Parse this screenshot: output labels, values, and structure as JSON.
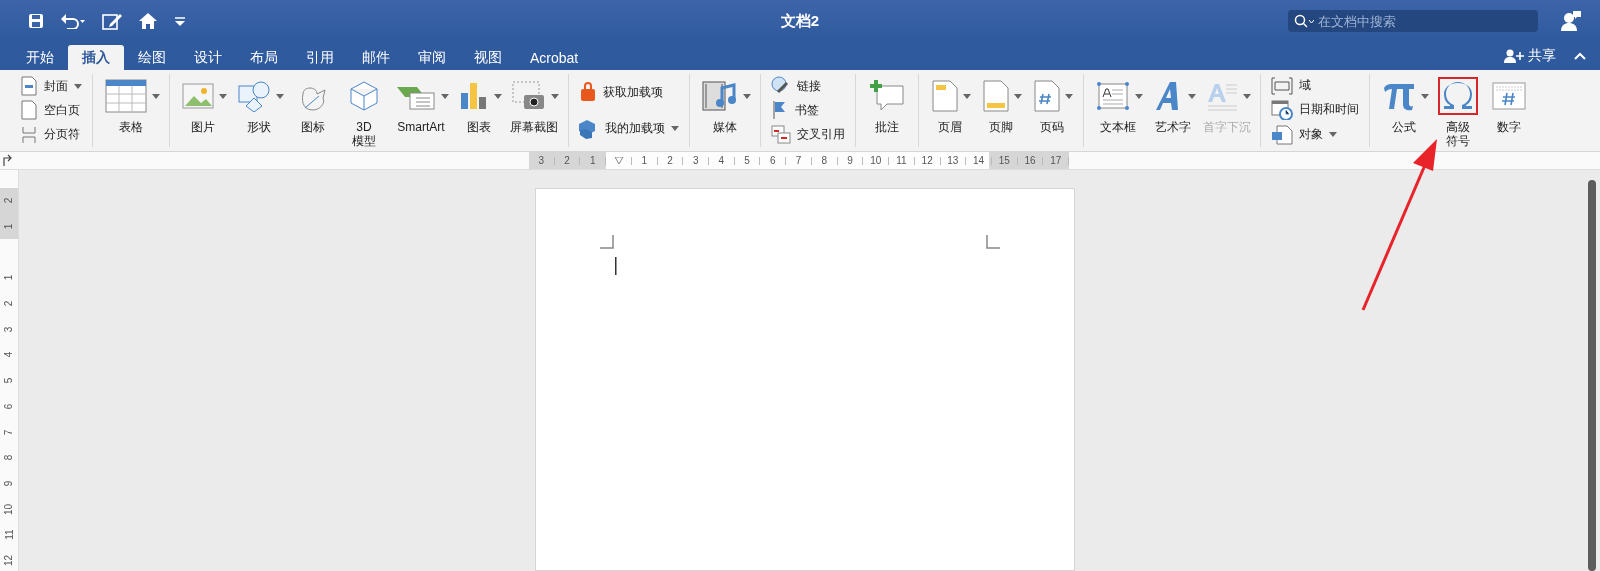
{
  "window": {
    "title": "文档2"
  },
  "search": {
    "placeholder": "在文档中搜索"
  },
  "tabs": [
    {
      "label": "开始",
      "selected": false
    },
    {
      "label": "插入",
      "selected": true
    },
    {
      "label": "绘图",
      "selected": false
    },
    {
      "label": "设计",
      "selected": false
    },
    {
      "label": "布局",
      "selected": false
    },
    {
      "label": "引用",
      "selected": false
    },
    {
      "label": "邮件",
      "selected": false
    },
    {
      "label": "审阅",
      "selected": false
    },
    {
      "label": "视图",
      "selected": false
    },
    {
      "label": "Acrobat",
      "selected": false
    }
  ],
  "share": {
    "label": "共享"
  },
  "ribbon_groups": [
    {
      "kind": "stack",
      "items": [
        {
          "label": "封面",
          "dropdown": true,
          "disabled": false
        },
        {
          "label": "空白页",
          "dropdown": false,
          "disabled": false
        },
        {
          "label": "分页符",
          "dropdown": false,
          "disabled": false
        }
      ]
    },
    {
      "kind": "large",
      "items": [
        {
          "lines": [
            "表格"
          ],
          "dropdown": true,
          "disabled": false,
          "highlighted": false
        }
      ]
    },
    {
      "kind": "large",
      "items": [
        {
          "lines": [
            "图片"
          ],
          "dropdown": true,
          "disabled": false,
          "highlighted": false
        },
        {
          "lines": [
            "形状"
          ],
          "dropdown": true,
          "disabled": false,
          "highlighted": false
        },
        {
          "lines": [
            "图标"
          ],
          "dropdown": false,
          "disabled": false,
          "highlighted": false
        },
        {
          "lines": [
            "3D",
            "模型"
          ],
          "dropdown": false,
          "disabled": false,
          "highlighted": false
        },
        {
          "lines": [
            "SmartArt"
          ],
          "dropdown": true,
          "disabled": false,
          "highlighted": false
        },
        {
          "lines": [
            "图表"
          ],
          "dropdown": true,
          "disabled": false,
          "highlighted": false
        },
        {
          "lines": [
            "屏幕截图"
          ],
          "dropdown": true,
          "disabled": false,
          "highlighted": false
        }
      ]
    },
    {
      "kind": "stack",
      "items": [
        {
          "label": "获取加载项",
          "dropdown": false,
          "disabled": false
        },
        {
          "label": "我的加载项",
          "dropdown": true,
          "disabled": false
        }
      ]
    },
    {
      "kind": "large",
      "items": [
        {
          "lines": [
            "媒体"
          ],
          "dropdown": true,
          "disabled": false,
          "highlighted": false
        }
      ]
    },
    {
      "kind": "stack",
      "items": [
        {
          "label": "链接",
          "dropdown": false,
          "disabled": false
        },
        {
          "label": "书签",
          "dropdown": false,
          "disabled": false
        },
        {
          "label": "交叉引用",
          "dropdown": false,
          "disabled": false
        }
      ]
    },
    {
      "kind": "large",
      "items": [
        {
          "lines": [
            "批注"
          ],
          "dropdown": false,
          "disabled": false,
          "highlighted": false
        }
      ]
    },
    {
      "kind": "large",
      "items": [
        {
          "lines": [
            "页眉"
          ],
          "dropdown": true,
          "disabled": false,
          "highlighted": false
        },
        {
          "lines": [
            "页脚"
          ],
          "dropdown": true,
          "disabled": false,
          "highlighted": false
        },
        {
          "lines": [
            "页码"
          ],
          "dropdown": true,
          "disabled": false,
          "highlighted": false
        }
      ]
    },
    {
      "kind": "large",
      "items": [
        {
          "lines": [
            "文本框"
          ],
          "dropdown": true,
          "disabled": false,
          "highlighted": false
        },
        {
          "lines": [
            "艺术字"
          ],
          "dropdown": true,
          "disabled": false,
          "highlighted": false
        },
        {
          "lines": [
            "首字下沉"
          ],
          "dropdown": true,
          "disabled": true,
          "highlighted": false
        }
      ]
    },
    {
      "kind": "stack",
      "items": [
        {
          "label": "域",
          "dropdown": false,
          "disabled": false
        },
        {
          "label": "日期和时间",
          "dropdown": false,
          "disabled": false
        },
        {
          "label": "对象",
          "dropdown": true,
          "disabled": false
        }
      ]
    },
    {
      "kind": "large",
      "items": [
        {
          "lines": [
            "公式"
          ],
          "dropdown": true,
          "disabled": false,
          "highlighted": false
        },
        {
          "lines": [
            "高级",
            "符号"
          ],
          "dropdown": false,
          "disabled": false,
          "highlighted": true
        },
        {
          "lines": [
            "数字"
          ],
          "dropdown": false,
          "disabled": false,
          "highlighted": false
        }
      ]
    }
  ],
  "horizontal_ruler": {
    "labels": [
      "3",
      "2",
      "1",
      "1",
      "2",
      "3",
      "4",
      "5",
      "6",
      "7",
      "8",
      "9",
      "10",
      "11",
      "12",
      "13",
      "14",
      "15",
      "16",
      "17"
    ]
  },
  "vertical_ruler": {
    "labels": [
      "2",
      "1",
      "1",
      "2",
      "3",
      "4",
      "5",
      "6",
      "7",
      "8",
      "9",
      "10",
      "11",
      "12"
    ]
  }
}
